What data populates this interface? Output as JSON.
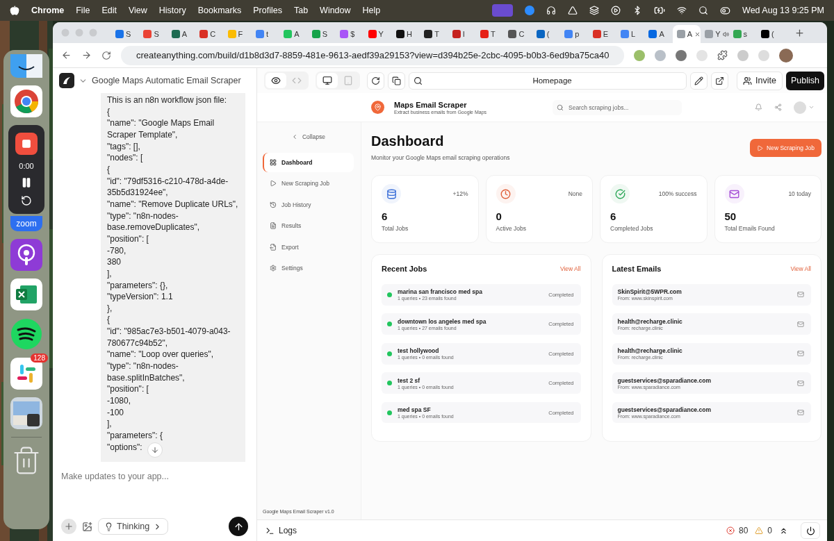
{
  "menu_bar": {
    "app": "Chrome",
    "menus": [
      "File",
      "Edit",
      "View",
      "History",
      "Bookmarks",
      "Profiles",
      "Tab",
      "Window",
      "Help"
    ],
    "clock": "Wed Aug 13  9:25 PM"
  },
  "dock": {
    "recorder_time": "0:00",
    "zoom_label": "zoom",
    "slack_badge": "128"
  },
  "browser": {
    "tabs": [
      {
        "label": "S",
        "color": "#1a73e8",
        "selected": false
      },
      {
        "label": "S",
        "color": "#ea4335",
        "selected": false
      },
      {
        "label": "A",
        "color": "#1e6b52",
        "selected": false
      },
      {
        "label": "C",
        "color": "#d93025",
        "selected": false
      },
      {
        "label": "F",
        "color": "#fbbc04",
        "selected": false
      },
      {
        "label": "t",
        "color": "#4285f4",
        "selected": false
      },
      {
        "label": "A",
        "color": "#22c55e",
        "selected": false
      },
      {
        "label": "S",
        "color": "#16a34a",
        "selected": false
      },
      {
        "label": "$",
        "color": "#a855f7",
        "selected": false
      },
      {
        "label": "Y",
        "color": "#ff0000",
        "selected": false
      },
      {
        "label": "H",
        "color": "#111111",
        "selected": false
      },
      {
        "label": "T",
        "color": "#222222",
        "selected": false
      },
      {
        "label": "I",
        "color": "#c5221f",
        "selected": false
      },
      {
        "label": "T",
        "color": "#e62117",
        "selected": false
      },
      {
        "label": "C",
        "color": "#555555",
        "selected": false
      },
      {
        "label": "(",
        "color": "#0a66c2",
        "selected": false
      },
      {
        "label": "p",
        "color": "#4285f4",
        "selected": false
      },
      {
        "label": "E",
        "color": "#d93025",
        "selected": false
      },
      {
        "label": "L",
        "color": "#4285f4",
        "selected": false
      },
      {
        "label": "A",
        "color": "#0668e1",
        "selected": false
      },
      {
        "label": "A",
        "color": "#9aa0a6",
        "selected": true
      },
      {
        "label": "Y",
        "color": "#9aa0a6",
        "selected": false
      },
      {
        "label": "s",
        "color": "#34a853",
        "selected": false
      },
      {
        "label": "(",
        "color": "#000000",
        "selected": false
      }
    ],
    "url": "createanything.com/build/d1b8d3d7-8859-481e-9613-aedf39a29153?view=d394b25e-2cbc-4095-b0b3-6ed9ba75ca40"
  },
  "chat": {
    "project": "Google Maps Automatic Email Scraper",
    "message_lines": [
      "This is an n8n workflow json file:",
      "{",
      "\"name\": \"Google Maps Email",
      "Scraper Template\",",
      "\"tags\": [],",
      "\"nodes\": [",
      "{",
      "\"id\": \"79df5316-c210-478d-a4de-",
      "35b5d31924ee\",",
      "\"name\": \"Remove Duplicate URLs\",",
      "\"type\": \"n8n-nodes-",
      "base.removeDuplicates\",",
      "\"position\": [",
      "-780,",
      "380",
      "],",
      "\"parameters\": {},",
      "\"typeVersion\": 1.1",
      "},",
      "{",
      "\"id\": \"985ac7e3-b501-4079-a043-",
      "780677c94b52\",",
      "\"name\": \"Loop over queries\",",
      "\"type\": \"n8n-nodes-",
      "base.splitInBatches\",",
      "\"position\": [",
      "-1080,",
      "-100",
      "],",
      "\"parameters\": {",
      "\"options\":"
    ],
    "input": {
      "placeholder": "Make updates to your app..."
    },
    "mode": "Thinking"
  },
  "preview": {
    "page": "Homepage",
    "invite": "Invite",
    "publish": "Publish"
  },
  "app": {
    "title": "Maps Email Scraper",
    "subtitle": "Extract business emails from Google Maps",
    "search": {
      "placeholder": "Search scraping jobs..."
    },
    "collapse": "Collapse",
    "nav": [
      {
        "label": "Dashboard",
        "selected": true
      },
      {
        "label": "New Scraping Job",
        "selected": false
      },
      {
        "label": "Job History",
        "selected": false
      },
      {
        "label": "Results",
        "selected": false
      },
      {
        "label": "Export",
        "selected": false
      },
      {
        "label": "Settings",
        "selected": false
      }
    ],
    "version": "Google Maps Email Scraper v1.0",
    "heading": "Dashboard",
    "description": "Monitor your Google Maps email scraping operations",
    "new_job": "New Scraping Job",
    "stats": [
      {
        "value": "6",
        "label": "Total Jobs",
        "note": "+12%",
        "color": "#3b6fd8"
      },
      {
        "value": "0",
        "label": "Active Jobs",
        "note": "None",
        "color": "#e0603a"
      },
      {
        "value": "6",
        "label": "Completed Jobs",
        "note": "100% success",
        "color": "#2fa85a"
      },
      {
        "value": "50",
        "label": "Total Emails Found",
        "note": "10 today",
        "color": "#a54ed6"
      }
    ],
    "recent_jobs": {
      "title": "Recent Jobs",
      "link": "View All",
      "rows": [
        {
          "name": "marina san francisco med spa",
          "detail": "1 queries • 23 emails found",
          "status": "Completed",
          "color": "#22c55e"
        },
        {
          "name": "downtown los angeles med spa",
          "detail": "1 queries • 27 emails found",
          "status": "Completed",
          "color": "#22c55e"
        },
        {
          "name": "test hollywood",
          "detail": "1 queries • 0 emails found",
          "status": "Completed",
          "color": "#22c55e"
        },
        {
          "name": "test 2 sf",
          "detail": "1 queries • 0 emails found",
          "status": "Completed",
          "color": "#22c55e"
        },
        {
          "name": "med spa SF",
          "detail": "1 queries • 0 emails found",
          "status": "Completed",
          "color": "#22c55e"
        }
      ]
    },
    "latest_emails": {
      "title": "Latest Emails",
      "link": "View All",
      "rows": [
        {
          "email": "SkinSpirit@5WPR.com",
          "source": "From: www.skinspirit.com"
        },
        {
          "email": "health@recharge.clinic",
          "source": "From: recharge.clinic"
        },
        {
          "email": "health@recharge.clinic",
          "source": "From: recharge.clinic"
        },
        {
          "email": "guestservices@sparadiance.com",
          "source": "From: www.sparadiance.com"
        },
        {
          "email": "guestservices@sparadiance.com",
          "source": "From: www.sparadiance.com"
        }
      ]
    }
  },
  "logs": {
    "label": "Logs",
    "errors": "80",
    "warnings": "0"
  }
}
